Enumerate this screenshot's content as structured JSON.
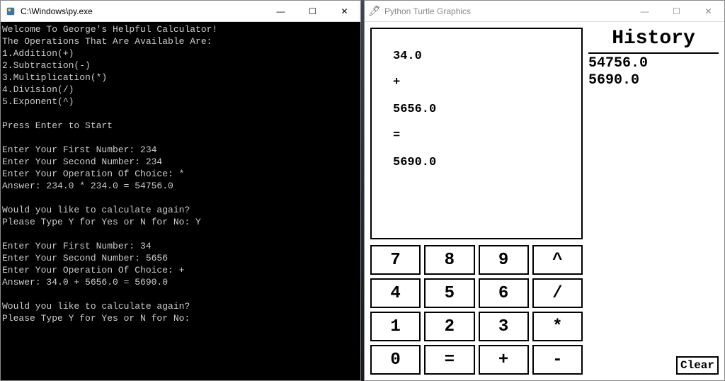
{
  "console": {
    "title": "C:\\Windows\\py.exe",
    "lines": [
      "Welcome To George's Helpful Calculator!",
      "The Operations That Are Available Are:",
      "1.Addition(+)",
      "2.Subtraction(-)",
      "3.Multiplication(*)",
      "4.Division(/)",
      "5.Exponent(^)",
      "",
      "Press Enter to Start",
      "",
      "Enter Your First Number: 234",
      "Enter Your Second Number: 234",
      "Enter Your Operation Of Choice: *",
      "Answer: 234.0 * 234.0 = 54756.0",
      "",
      "Would you like to calculate again?",
      "Please Type Y for Yes or N for No: Y",
      "",
      "Enter Your First Number: 34",
      "Enter Your Second Number: 5656",
      "Enter Your Operation Of Choice: +",
      "Answer: 34.0 + 5656.0 = 5690.0",
      "",
      "Would you like to calculate again?",
      "Please Type Y for Yes or N for No:"
    ]
  },
  "turtle": {
    "title": "Python Turtle Graphics",
    "display": [
      "34.0",
      "+",
      "5656.0",
      "=",
      "5690.0"
    ],
    "keys": [
      "7",
      "8",
      "9",
      "^",
      "4",
      "5",
      "6",
      "/",
      "1",
      "2",
      "3",
      "*",
      "0",
      "=",
      "+",
      "-"
    ],
    "history_title": "History",
    "history": [
      "54756.0",
      "5690.0"
    ],
    "clear_label": "Clear"
  },
  "window_controls": {
    "minimize": "—",
    "maximize": "☐",
    "close": "✕"
  }
}
